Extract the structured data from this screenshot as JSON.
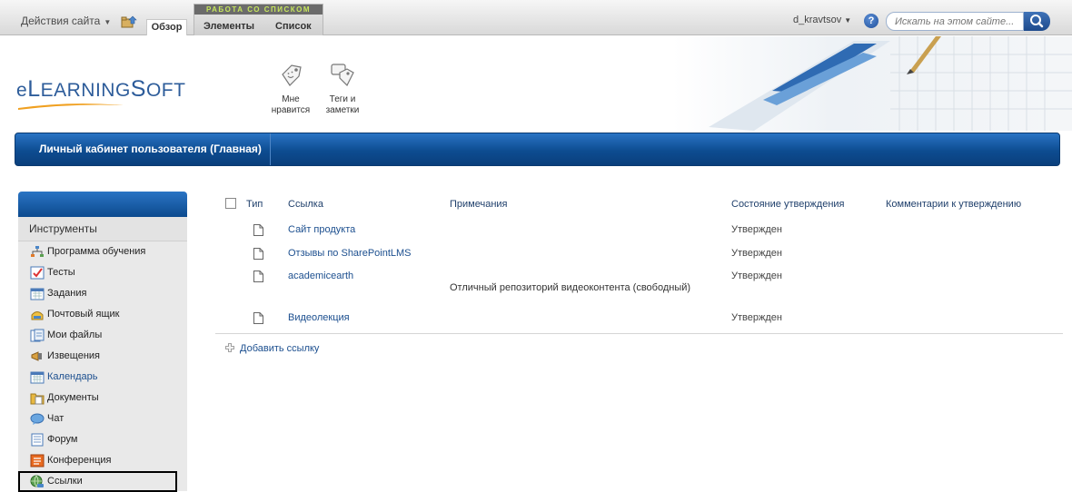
{
  "topbar": {
    "site_actions": "Действия сайта",
    "tab_overview": "Обзор",
    "context_group_label": "РАБОТА СО СПИСКОМ",
    "context_tabs": [
      "Элементы",
      "Список"
    ],
    "user": "d_kravtsov",
    "search_placeholder": "Искать на этом сайте..."
  },
  "header": {
    "logo_initial": "e",
    "logo_big_l": "L",
    "logo_rest_1": "EARNING",
    "logo_big_s": "S",
    "logo_rest_2": "OFT",
    "buttons": [
      {
        "line1": "Мне",
        "line2": "нравится",
        "icon": "like-tag-icon"
      },
      {
        "line1": "Теги и",
        "line2": "заметки",
        "icon": "tags-notes-icon"
      }
    ]
  },
  "titlebar": {
    "title": "Личный кабинет пользователя (Главная)"
  },
  "sidebar": {
    "section_title": "Инструменты",
    "items": [
      {
        "label": "Программа обучения",
        "icon": "org-chart-icon",
        "link": false
      },
      {
        "label": "Тесты",
        "icon": "test-icon",
        "link": false
      },
      {
        "label": "Задания",
        "icon": "tasks-icon",
        "link": false
      },
      {
        "label": "Почтовый ящик",
        "icon": "mailbox-icon",
        "link": false
      },
      {
        "label": "Мои файлы",
        "icon": "files-icon",
        "link": false
      },
      {
        "label": "Извещения",
        "icon": "megaphone-icon",
        "link": false
      },
      {
        "label": "Календарь",
        "icon": "calendar-icon",
        "link": true
      },
      {
        "label": "Документы",
        "icon": "documents-icon",
        "link": false
      },
      {
        "label": "Чат",
        "icon": "chat-icon",
        "link": false
      },
      {
        "label": "Форум",
        "icon": "forum-icon",
        "link": false
      },
      {
        "label": "Конференция",
        "icon": "conference-icon",
        "link": false
      },
      {
        "label": "Ссылки",
        "icon": "links-globe-icon",
        "link": false,
        "selected": true
      }
    ]
  },
  "table": {
    "columns": [
      "Тип",
      "Ссылка",
      "Примечания",
      "Состояние утверждения",
      "Комментарии к утверждению"
    ],
    "rows": [
      {
        "link": "Сайт продукта",
        "note": "",
        "status": "Утвержден"
      },
      {
        "link": "Отзывы по SharePointLMS",
        "note": "",
        "status": "Утвержден"
      },
      {
        "link": "academicearth",
        "note": "Отличный репозиторий видеоконтента (свободный)",
        "status": "Утвержден"
      },
      {
        "link": "Видеолекция",
        "note": "",
        "status": "Утвержден"
      }
    ],
    "add_link": "Добавить ссылку"
  },
  "colors": {
    "brand_blue": "#0d4c91",
    "link_blue": "#1c4f8f",
    "context_green": "#c6e65c"
  }
}
